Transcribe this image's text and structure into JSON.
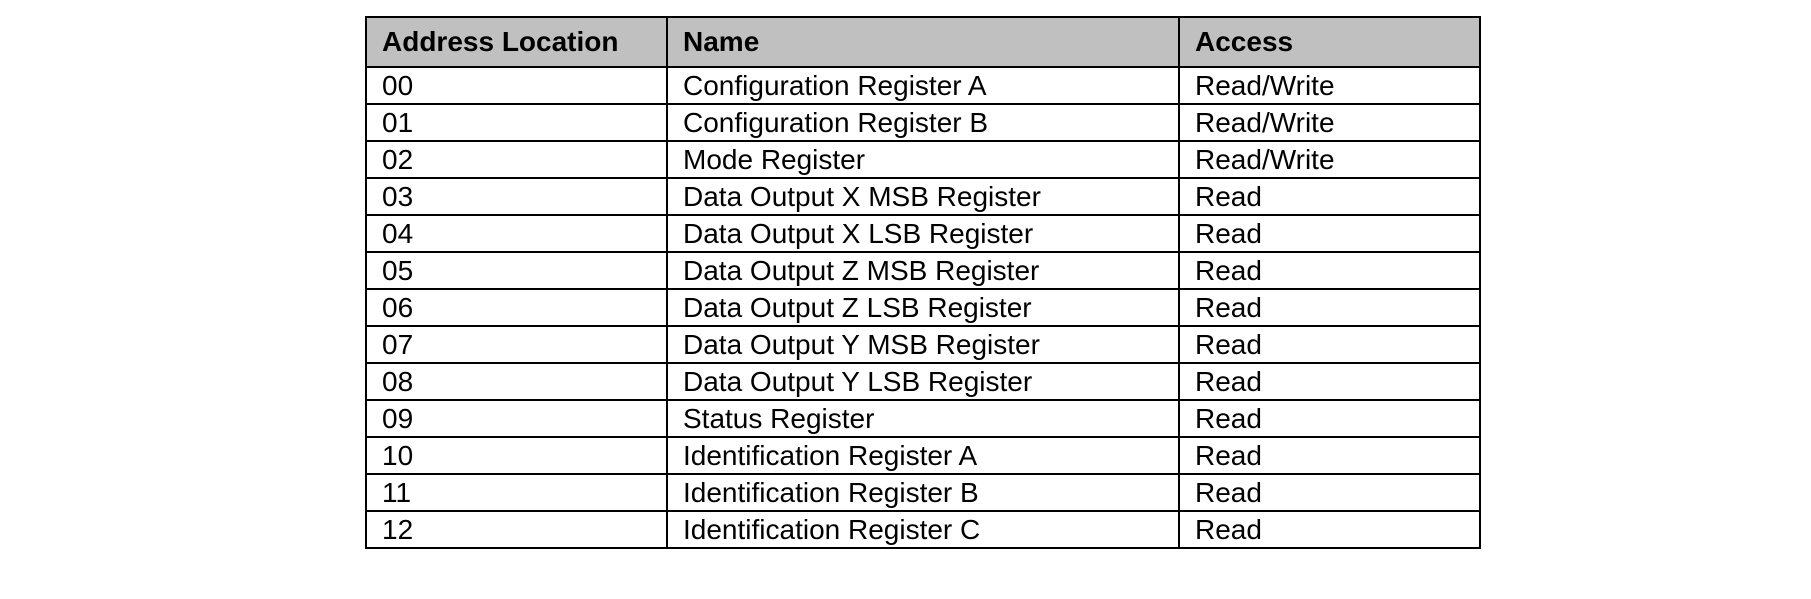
{
  "table": {
    "headers": [
      "Address Location",
      "Name",
      "Access"
    ],
    "rows": [
      [
        "00",
        "Configuration Register A",
        "Read/Write"
      ],
      [
        "01",
        "Configuration Register B",
        "Read/Write"
      ],
      [
        "02",
        "Mode Register",
        "Read/Write"
      ],
      [
        "03",
        "Data Output X MSB Register",
        "Read"
      ],
      [
        "04",
        "Data Output X LSB Register",
        "Read"
      ],
      [
        "05",
        "Data Output Z MSB Register",
        "Read"
      ],
      [
        "06",
        "Data Output Z LSB Register",
        "Read"
      ],
      [
        "07",
        "Data Output Y MSB Register",
        "Read"
      ],
      [
        "08",
        "Data Output Y LSB Register",
        "Read"
      ],
      [
        "09",
        "Status Register",
        "Read"
      ],
      [
        "10",
        "Identification Register A",
        "Read"
      ],
      [
        "11",
        "Identification Register B",
        "Read"
      ],
      [
        "12",
        "Identification Register C",
        "Read"
      ]
    ]
  }
}
